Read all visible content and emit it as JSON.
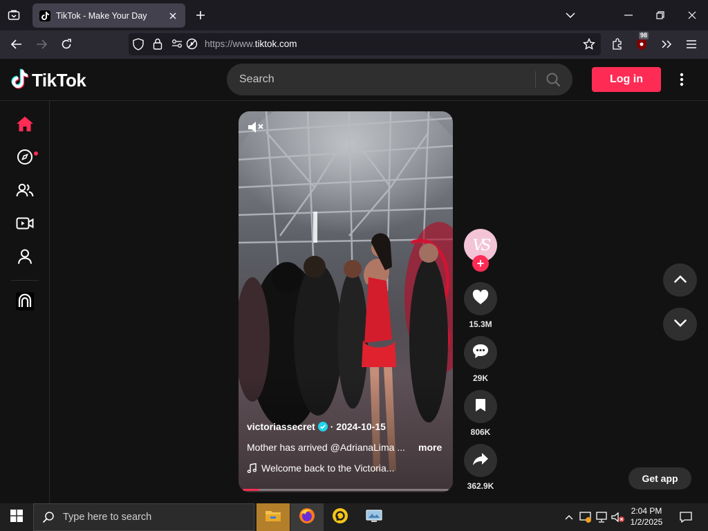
{
  "browser": {
    "tab_title": "TikTok - Make Your Day",
    "url_protocol": "https://www.",
    "url_host": "tiktok.com",
    "extension_badge": "98"
  },
  "header": {
    "logo_text": "TikTok",
    "search_placeholder": "Search",
    "login_label": "Log in"
  },
  "sidebar": {
    "items": [
      {
        "name": "home",
        "icon": "home-icon",
        "active": true
      },
      {
        "name": "explore",
        "icon": "compass-icon",
        "dot": true
      },
      {
        "name": "following",
        "icon": "people-icon"
      },
      {
        "name": "live",
        "icon": "live-camera-icon"
      },
      {
        "name": "profile",
        "icon": "person-icon"
      },
      {
        "name": "effects",
        "icon": "effect-house-icon"
      }
    ]
  },
  "video": {
    "author": "victoriassecret",
    "date": "2024-10-15",
    "date_separator": " · ",
    "caption": "Mother has arrived @AdrianaLima ...",
    "more_label": "more",
    "music": "Welcome back to the Victoria...",
    "progress": 0.08
  },
  "actions": {
    "avatar_text": "VS",
    "likes": "15.3M",
    "comments": "29K",
    "saves": "806K",
    "shares": "362.9K"
  },
  "get_app_label": "Get app",
  "taskbar": {
    "search_placeholder": "Type here to search",
    "time": "2:04 PM",
    "date": "1/2/2025"
  },
  "colors": {
    "brand": "#fe2c55",
    "background": "#121212",
    "surface": "#2f2f2f"
  }
}
